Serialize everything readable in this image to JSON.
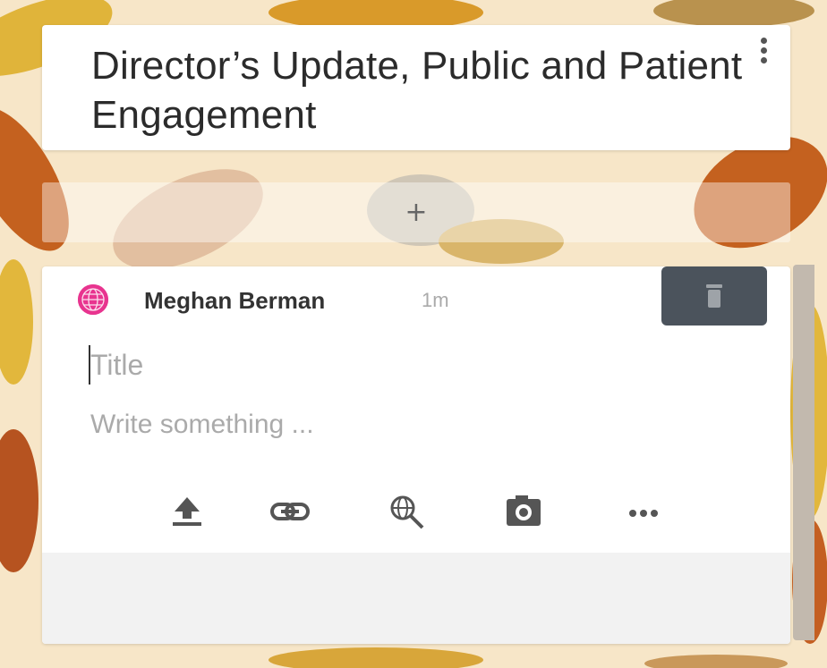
{
  "header": {
    "title": "Director’s Update, Public and Patient Engagement"
  },
  "add_post": {
    "plus": "+"
  },
  "post": {
    "author": "Meghan Berman",
    "time": "1m",
    "title_placeholder": "Title",
    "body_placeholder": "Write something ...",
    "avatar_color": "#e8348f"
  },
  "toolbar": {
    "icons": [
      "upload-icon",
      "link-icon",
      "search-web-icon",
      "camera-icon",
      "more-icon"
    ]
  },
  "colors": {
    "background": "#f7e6c8",
    "delete_button": "#4b535c",
    "icon": "#555555"
  }
}
